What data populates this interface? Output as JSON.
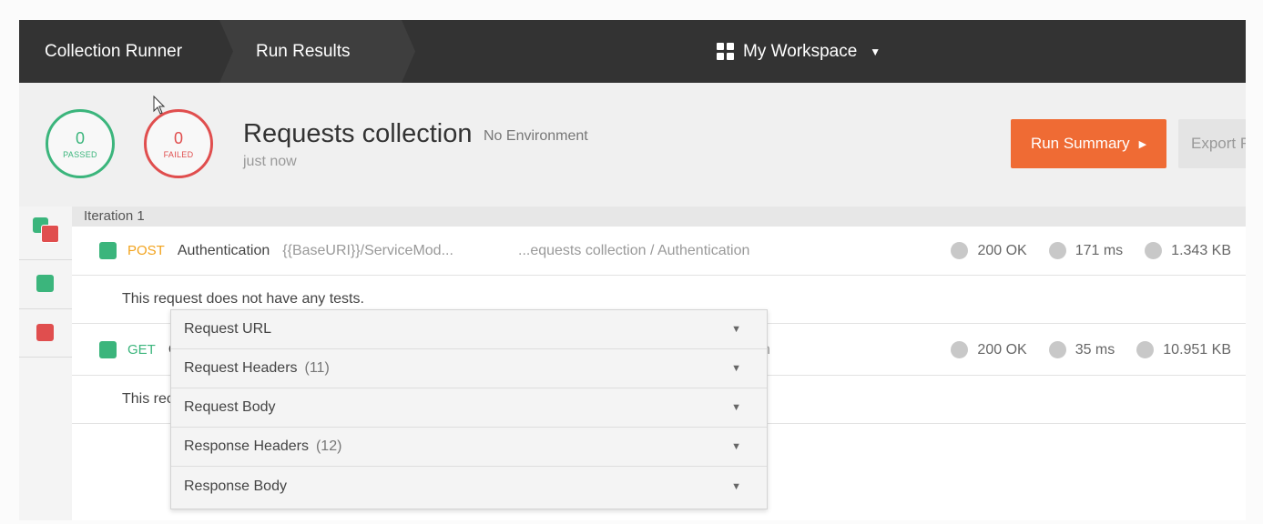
{
  "topbar": {
    "crumb1": "Collection Runner",
    "crumb2": "Run Results",
    "workspace": "My Workspace",
    "workspace_icon": "grid-icon",
    "caret": "▼"
  },
  "summary": {
    "passed_count": "0",
    "passed_label": "PASSED",
    "failed_count": "0",
    "failed_label": "FAILED",
    "title": "Requests collection",
    "environment": "No Environment",
    "time": "just now",
    "run_summary_label": "Run Summary",
    "export_label": "Export R"
  },
  "iteration": {
    "label": "Iteration 1"
  },
  "requests": [
    {
      "method": "POST",
      "name": "Authentication",
      "url": "{{BaseURI}}/ServiceMod...",
      "path": "...equests collection / Authentication",
      "status": "200 OK",
      "time": "171 ms",
      "size": "1.343 KB",
      "message": "This request does not have any tests."
    },
    {
      "method": "GET",
      "name": "C",
      "path": "n",
      "status": "200 OK",
      "time": "35 ms",
      "size": "10.951 KB",
      "message": "This rec"
    }
  ],
  "dropdown": {
    "items": [
      {
        "label": "Request URL",
        "count": ""
      },
      {
        "label": "Request Headers",
        "count": "(11)"
      },
      {
        "label": "Request Body",
        "count": ""
      },
      {
        "label": "Response Headers",
        "count": "(12)"
      },
      {
        "label": "Response Body",
        "count": ""
      }
    ],
    "caret": "▼"
  },
  "colors": {
    "topbar": "#333333",
    "accent": "#ef6b34",
    "pass": "#3bb57c",
    "fail": "#e04e4e",
    "post": "#f2a31d"
  }
}
